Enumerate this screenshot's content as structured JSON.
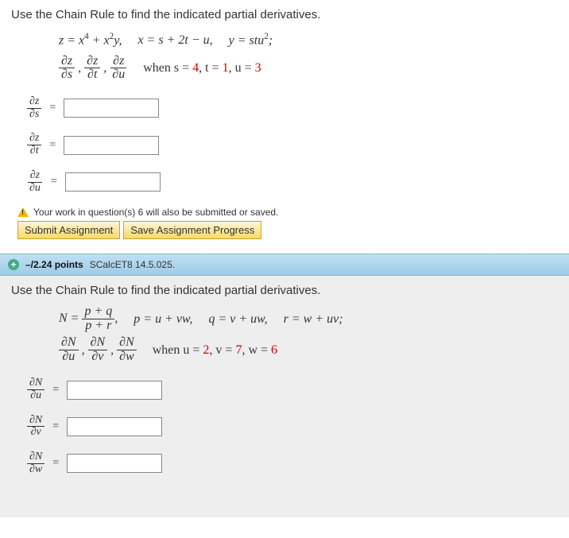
{
  "q1": {
    "prompt": "Use the Chain Rule to find the indicated partial derivatives.",
    "eq_z": "z = x⁴ + x²y,",
    "eq_x": "x = s + 2t − u,",
    "eq_y": "y = stu²;",
    "partial_list_1": "∂z",
    "partial_list_2": "∂s",
    "partial_list_3": "∂t",
    "partial_list_4": "∂u",
    "when_pre": "when s = ",
    "val_s": "4",
    "mid_t": ", t = ",
    "val_t": "1",
    "mid_u": ", u = ",
    "val_u": "3",
    "ans1_num": "∂z",
    "ans1_den": "∂s",
    "ans2_num": "∂z",
    "ans2_den": "∂t",
    "ans3_num": "∂z",
    "ans3_den": "∂u"
  },
  "buttons": {
    "warning": "Your work in question(s) 6 will also be submitted or saved.",
    "submit": "Submit Assignment",
    "save": "Save Assignment Progress"
  },
  "q2header": {
    "points": "–/2.24 points",
    "source": "SCalcET8 14.5.025."
  },
  "q2": {
    "prompt": "Use the Chain Rule to find the indicated partial derivatives.",
    "eq_N_top": "p + q",
    "eq_N_bot": "p + r",
    "eq_N_pre": "N =",
    "eq_N_post": ",",
    "eq_p": "p = u + vw,",
    "eq_q": "q = v + uw,",
    "eq_r": "r = w + uv;",
    "partials_top": "∂N",
    "partial_du": "∂u",
    "partial_dv": "∂v",
    "partial_dw": "∂w",
    "when_pre": "when u = ",
    "val_u": "2",
    "mid_v": ", v = ",
    "val_v": "7",
    "mid_w": ", w = ",
    "val_w": "6",
    "ans1_num": "∂N",
    "ans1_den": "∂u",
    "ans2_num": "∂N",
    "ans2_den": "∂v",
    "ans3_num": "∂N",
    "ans3_den": "∂w"
  },
  "eq_sign": "="
}
